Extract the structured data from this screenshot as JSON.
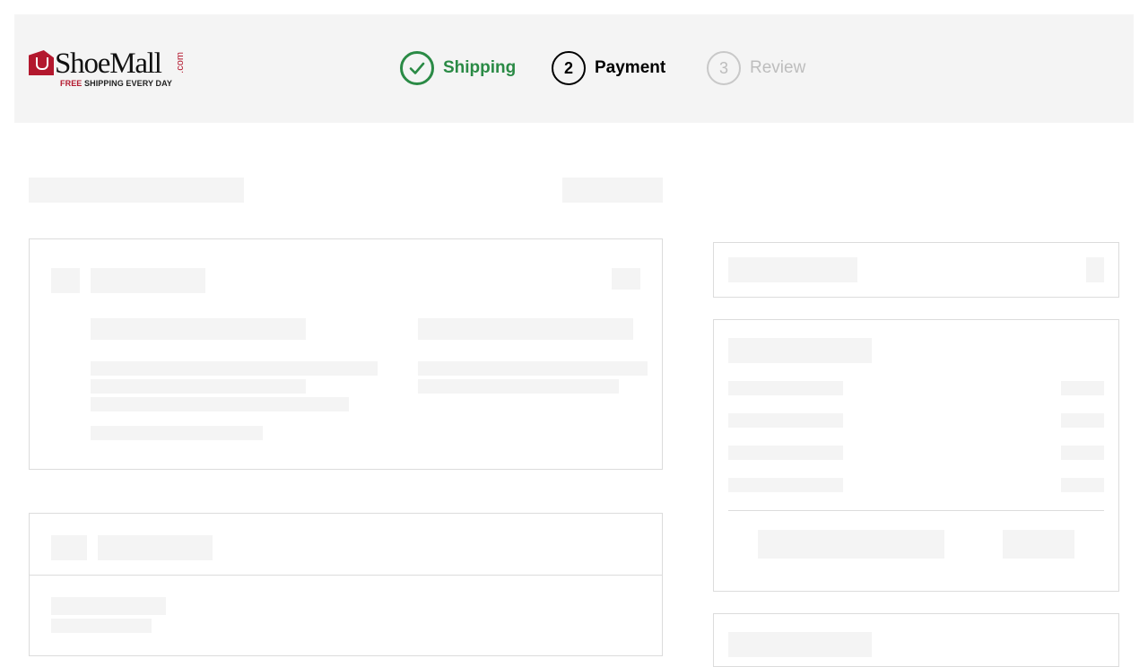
{
  "brand": {
    "name": "ShoeMall",
    "domain_suffix": ".com",
    "tagline_highlight": "FREE",
    "tagline_rest": " SHIPPING EVERY DAY",
    "accent_color": "#b3182e"
  },
  "stepper": {
    "steps": [
      {
        "number": "1",
        "label": "Shipping",
        "state": "complete",
        "icon": "check-icon"
      },
      {
        "number": "2",
        "label": "Payment",
        "state": "active"
      },
      {
        "number": "3",
        "label": "Review",
        "state": "pending"
      }
    ],
    "complete_color": "#2a8a45"
  },
  "content_state": "loading"
}
